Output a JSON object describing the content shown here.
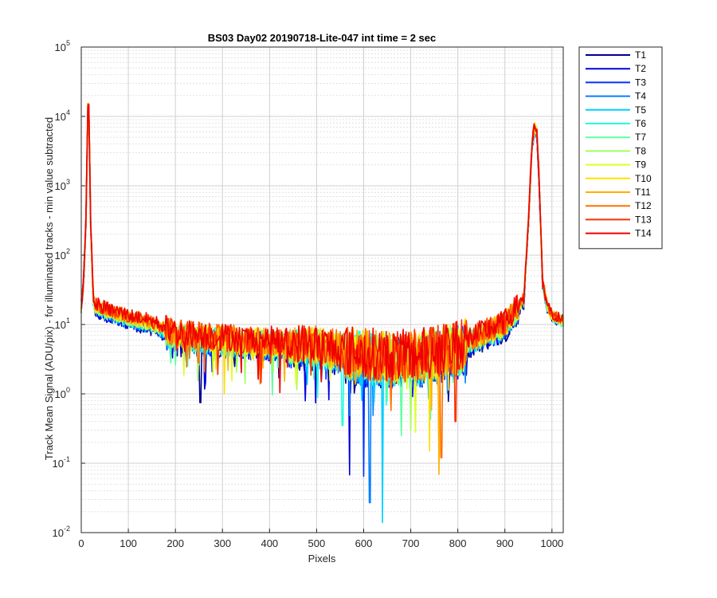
{
  "chart_data": {
    "type": "line",
    "title": "BS03 Day02 20190718-Lite-047 int time = 2 sec",
    "xlabel": "Pixels",
    "ylabel": "Track Mean Signal (ADU/pix) - for illuminated tracks - min value subtracted",
    "xlim": [
      0,
      1024
    ],
    "ylim": [
      0.01,
      100000
    ],
    "yscale": "log",
    "grid": "major-and-minor",
    "legend": "outside-top-right",
    "x_ticks": [
      "0",
      "100",
      "200",
      "300",
      "400",
      "500",
      "600",
      "700",
      "800",
      "900",
      "1000"
    ],
    "y_ticks": [
      {
        "base": "10",
        "exp": "-2"
      },
      {
        "base": "10",
        "exp": "-1"
      },
      {
        "base": "10",
        "exp": "0"
      },
      {
        "base": "10",
        "exp": "1"
      },
      {
        "base": "10",
        "exp": "2"
      },
      {
        "base": "10",
        "exp": "3"
      },
      {
        "base": "10",
        "exp": "4"
      },
      {
        "base": "10",
        "exp": "5"
      }
    ],
    "profile": {
      "x": [
        0,
        5,
        10,
        13,
        15,
        17,
        20,
        25,
        30,
        50,
        100,
        150,
        200,
        300,
        400,
        500,
        600,
        700,
        800,
        900,
        940,
        950,
        958,
        963,
        968,
        972,
        980,
        990,
        1000,
        1024
      ],
      "y": [
        18,
        40,
        300,
        6000,
        24000,
        6000,
        300,
        25,
        16,
        14,
        11,
        9,
        6.5,
        5.5,
        5,
        4.5,
        3.5,
        3.2,
        4.5,
        9,
        20,
        300,
        4000,
        7000,
        5500,
        1500,
        40,
        18,
        13,
        11
      ]
    },
    "dips": [
      {
        "x": 253,
        "y": 0.75
      },
      {
        "x": 570,
        "y": 0.068
      },
      {
        "x": 600,
        "y": 0.065
      },
      {
        "x": 613,
        "y": 0.027
      },
      {
        "x": 640,
        "y": 0.014
      },
      {
        "x": 555,
        "y": 0.35
      },
      {
        "x": 680,
        "y": 0.25
      },
      {
        "x": 700,
        "y": 0.3
      },
      {
        "x": 710,
        "y": 0.28
      },
      {
        "x": 740,
        "y": 0.15
      },
      {
        "x": 760,
        "y": 0.069
      },
      {
        "x": 765,
        "y": 0.12
      },
      {
        "x": 795,
        "y": 0.4
      }
    ],
    "series": [
      {
        "name": "T1",
        "color": "#00008f"
      },
      {
        "name": "T2",
        "color": "#0000df"
      },
      {
        "name": "T3",
        "color": "#0030ff"
      },
      {
        "name": "T4",
        "color": "#0080ff"
      },
      {
        "name": "T5",
        "color": "#00cfff"
      },
      {
        "name": "T6",
        "color": "#20ffdf"
      },
      {
        "name": "T7",
        "color": "#60ffa0"
      },
      {
        "name": "T8",
        "color": "#9fff60"
      },
      {
        "name": "T9",
        "color": "#dfff20"
      },
      {
        "name": "T10",
        "color": "#ffdf00"
      },
      {
        "name": "T11",
        "color": "#ffb000"
      },
      {
        "name": "T12",
        "color": "#ff7000"
      },
      {
        "name": "T13",
        "color": "#ff3000"
      },
      {
        "name": "T14",
        "color": "#ee0000"
      }
    ]
  }
}
